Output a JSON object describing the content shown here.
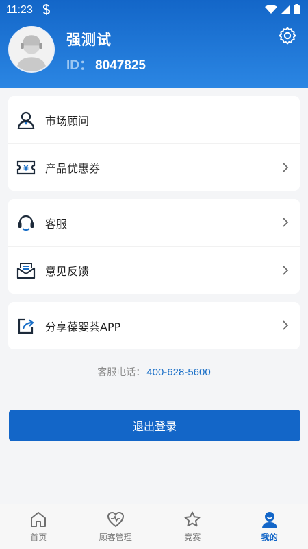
{
  "status_bar": {
    "time": "11:23"
  },
  "profile": {
    "name": "强测试",
    "id_label": "ID：",
    "id_value": "8047825"
  },
  "menu_group_1": [
    {
      "label": "市场顾问",
      "icon": "advisor-icon",
      "has_arrow": false
    },
    {
      "label": "产品优惠券",
      "icon": "coupon-icon",
      "has_arrow": true
    }
  ],
  "menu_group_2": [
    {
      "label": "客服",
      "icon": "headset-icon",
      "has_arrow": true
    },
    {
      "label": "意见反馈",
      "icon": "feedback-mail-icon",
      "has_arrow": true
    }
  ],
  "menu_group_3": [
    {
      "label": "分享葆婴荟APP",
      "icon": "share-icon",
      "has_arrow": true
    }
  ],
  "hotline": {
    "label": "客服电话：",
    "number": "400-628-5600"
  },
  "logout_label": "退出登录",
  "bottom_nav": [
    {
      "label": "首页",
      "icon": "home-icon",
      "active": false
    },
    {
      "label": "顾客管理",
      "icon": "heart-customer-icon",
      "active": false
    },
    {
      "label": "竞赛",
      "icon": "star-icon",
      "active": false
    },
    {
      "label": "我的",
      "icon": "profile-icon",
      "active": true
    }
  ],
  "colors": {
    "brand_blue": "#1366c8",
    "link_blue": "#1a6fc7"
  }
}
